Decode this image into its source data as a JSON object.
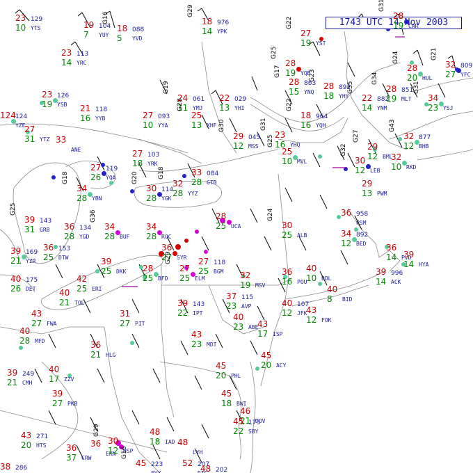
{
  "title": "1743 UTC 14 Nov 2003",
  "colors": {
    "background": "#ffffff",
    "boundary": "#7a7a7a",
    "temperature": "#cc0000",
    "dewpoint": "#008800",
    "station_id": "#1a1aa0",
    "wind_barb": "#000000",
    "gust": "#000000",
    "weather": "#a000a0",
    "cloud_clear": "#55cc99",
    "cloud_broken": "#2222cc",
    "cloud_overcast": "#d400d4",
    "cloud_obscured": "#dd0000"
  },
  "legend_note": "Temperature (red) upper-left, dewpoint (green) lower-left, pressure/station right",
  "stations": [
    {
      "id": "YTS",
      "t": "23",
      "td": "10",
      "p": "129",
      "c": "",
      "g": ""
    },
    {
      "id": "YUY",
      "t": "19",
      "td": "7",
      "p": "104",
      "c": "",
      "g": ""
    },
    {
      "id": "YVD",
      "t": "18",
      "td": "5",
      "p": "088",
      "c": "",
      "g": "G16"
    },
    {
      "id": "YPK",
      "t": "18",
      "td": "14",
      "p": "976",
      "c": "",
      "g": "G29"
    },
    {
      "id": "YST",
      "t": "27",
      "td": "19",
      "p": "",
      "c": "",
      "g": "G22"
    },
    {
      "id": "CAR",
      "t": "28",
      "td": "19",
      "p": "",
      "c": "broken",
      "g": "G31"
    },
    {
      "id": "YRC",
      "t": "23",
      "td": "14",
      "p": "113",
      "c": "",
      "g": ""
    },
    {
      "id": "YQB",
      "t": "28",
      "td": "19",
      "p": "",
      "c": "obscured",
      "g": "G25"
    },
    {
      "id": "HUL",
      "t": "28",
      "td": "20",
      "p": "",
      "c": "clear",
      "g": "G24"
    },
    {
      "id": "YFC",
      "t": "32",
      "td": "27",
      "p": "809",
      "c": "broken",
      "g": "G21"
    },
    {
      "id": "YSB",
      "t": "23",
      "td": "19",
      "p": "126",
      "c": "clear",
      "g": ""
    },
    {
      "id": "YYB",
      "t": "21",
      "td": "16",
      "p": "118",
      "c": "",
      "g": ""
    },
    {
      "id": "YYA",
      "t": "27",
      "td": "10",
      "p": "093",
      "c": "",
      "g": ""
    },
    {
      "id": "YMJ",
      "t": "24",
      "td": "11",
      "p": "061",
      "c": "",
      "g": "G19"
    },
    {
      "id": "YHI",
      "t": "22",
      "td": "13",
      "p": "029",
      "c": "",
      "g": ""
    },
    {
      "id": "YHY",
      "t": "28",
      "td": "18",
      "p": "892",
      "c": "",
      "g": "G23"
    },
    {
      "id": "YNM",
      "t": "22",
      "td": "14",
      "p": "882",
      "c": "",
      "g": "G35"
    },
    {
      "id": "MLT",
      "t": "28",
      "td": "19",
      "p": "851",
      "c": "",
      "g": "G34"
    },
    {
      "id": "YSJ",
      "t": "34",
      "td": "23",
      "p": "",
      "c": "clear",
      "g": "G31"
    },
    {
      "id": "XHF",
      "t": "25",
      "td": "13",
      "p": "",
      "c": "",
      "g": "G28"
    },
    {
      "id": "YNQ",
      "t": "28",
      "td": "15",
      "p": "863",
      "c": "",
      "g": "G17"
    },
    {
      "id": "YTZ",
      "t": "27",
      "td": "31",
      "p": "",
      "c": "",
      "g": ""
    },
    {
      "id": "YZE",
      "t": "124",
      "td": "",
      "p": "124",
      "c": "clear",
      "g": ""
    },
    {
      "id": "ANE",
      "t": "33",
      "td": "",
      "p": "",
      "c": "",
      "g": ""
    },
    {
      "id": "MSS",
      "t": "29",
      "td": "12",
      "p": "045",
      "c": "",
      "g": "G30"
    },
    {
      "id": "YHQ",
      "t": "23",
      "td": "16",
      "p": "",
      "c": "",
      "g": "G31"
    },
    {
      "id": "YQH",
      "t": "18",
      "td": "16",
      "p": "964",
      "c": "",
      "g": "G22"
    },
    {
      "id": "BHB",
      "t": "32",
      "td": "12",
      "p": "877",
      "c": "clear",
      "g": "G43"
    },
    {
      "id": "YRK",
      "t": "27",
      "td": "18",
      "p": "103",
      "c": "",
      "g": ""
    },
    {
      "id": "YQA",
      "t": "27",
      "td": "26",
      "p": "119",
      "c": "broken",
      "g": ""
    },
    {
      "id": "YGK",
      "t": "30",
      "td": "28",
      "p": "114",
      "c": "broken",
      "g": "G20"
    },
    {
      "id": "YYZ",
      "t": "32",
      "td": "28",
      "p": "",
      "c": "",
      "g": "G18"
    },
    {
      "id": "GTB",
      "t": "33",
      "td": "28",
      "p": "084",
      "c": "",
      "g": ""
    },
    {
      "id": "MVL",
      "t": "25",
      "td": "10",
      "p": "",
      "c": "clear",
      "g": "G25"
    },
    {
      "id": "LEB",
      "t": "30",
      "td": "12",
      "p": "",
      "c": "broken",
      "g": "G32"
    },
    {
      "id": "RKD",
      "t": "32",
      "td": "10",
      "p": "",
      "c": "clear",
      "g": ""
    },
    {
      "id": "BML",
      "t": "29",
      "td": "12",
      "p": "",
      "c": "",
      "g": "G27"
    },
    {
      "id": "PWM",
      "t": "29",
      "td": "13",
      "p": "",
      "c": "",
      "g": ""
    },
    {
      "id": "YBN",
      "t": "34",
      "td": "28",
      "p": "",
      "c": "clear",
      "g": "G18"
    },
    {
      "id": "GRB",
      "t": "39",
      "td": "31",
      "p": "143",
      "c": "",
      "g": "G25"
    },
    {
      "id": "YGD",
      "t": "36",
      "td": "28",
      "p": "134",
      "c": "",
      "g": ""
    },
    {
      "id": "BUF",
      "t": "34",
      "td": "28",
      "p": "",
      "c": "overcast",
      "g": "G36"
    },
    {
      "id": "UCA",
      "t": "28",
      "td": "25",
      "p": "",
      "c": "overcast",
      "g": ""
    },
    {
      "id": "ALB",
      "t": "30",
      "td": "25",
      "p": "",
      "c": "",
      "g": "G24"
    },
    {
      "id": "PSM",
      "t": "36",
      "td": "",
      "p": "958",
      "c": "",
      "g": ""
    },
    {
      "id": "BED",
      "t": "34",
      "td": "12",
      "p": "892",
      "c": "clear",
      "g": ""
    },
    {
      "id": "ROC",
      "t": "34",
      "td": "28",
      "p": "",
      "c": "overcast",
      "g": ""
    },
    {
      "id": "YZR",
      "t": "39",
      "td": "21",
      "p": "169",
      "c": "clear",
      "g": ""
    },
    {
      "id": "DTW",
      "t": "36",
      "td": "25",
      "p": "153",
      "c": "",
      "g": ""
    },
    {
      "id": "SYR",
      "t": "36",
      "td": "27",
      "p": "",
      "c": "obscured",
      "g": ""
    },
    {
      "id": "ELM",
      "t": "27",
      "td": "25",
      "p": "",
      "c": "overcast",
      "g": "G29"
    },
    {
      "id": "BGM",
      "t": "27",
      "td": "25",
      "p": "118",
      "c": "",
      "g": ""
    },
    {
      "id": "ACK",
      "t": "39",
      "td": "14",
      "p": "996",
      "c": "",
      "g": ""
    },
    {
      "id": "PVD",
      "t": "36",
      "td": "14",
      "p": "",
      "c": "",
      "g": ""
    },
    {
      "id": "HYA",
      "t": "39",
      "td": "14",
      "p": "",
      "c": "",
      "g": ""
    },
    {
      "id": "DKK",
      "t": "39",
      "td": "25",
      "p": "",
      "c": "",
      "g": ""
    },
    {
      "id": "ERI",
      "t": "42",
      "td": "25",
      "p": "",
      "c": "",
      "g": ""
    },
    {
      "id": "BFD",
      "t": "28",
      "td": "25",
      "p": "",
      "c": "clear",
      "g": ""
    },
    {
      "id": "MSV",
      "t": "32",
      "td": "19",
      "p": "",
      "c": "",
      "g": ""
    },
    {
      "id": "POU",
      "t": "36",
      "td": "16",
      "p": "",
      "c": "",
      "g": ""
    },
    {
      "id": "BDL",
      "t": "40",
      "td": "10",
      "p": "",
      "c": "",
      "g": ""
    },
    {
      "id": "BID",
      "t": "40",
      "td": "8",
      "p": "",
      "c": "",
      "g": ""
    },
    {
      "id": "DET",
      "t": "40",
      "td": "26",
      "p": "175",
      "c": "",
      "g": ""
    },
    {
      "id": "TOL",
      "t": "40",
      "td": "21",
      "p": "",
      "c": "",
      "g": ""
    },
    {
      "id": "AVP",
      "t": "37",
      "td": "23",
      "p": "115",
      "c": "",
      "g": ""
    },
    {
      "id": "FOK",
      "t": "43",
      "td": "12",
      "p": "",
      "c": "",
      "g": ""
    },
    {
      "id": "JFK",
      "t": "40",
      "td": "12",
      "p": "107",
      "c": "",
      "g": ""
    },
    {
      "id": "FWA",
      "t": "43",
      "td": "27",
      "p": "",
      "c": "",
      "g": ""
    },
    {
      "id": "MFD",
      "t": "40",
      "td": "28",
      "p": "",
      "c": "",
      "g": ""
    },
    {
      "id": "PIT",
      "t": "31",
      "td": "27",
      "p": "",
      "c": "",
      "g": ""
    },
    {
      "id": "IPT",
      "t": "39",
      "td": "22",
      "p": "143",
      "c": "",
      "g": ""
    },
    {
      "id": "ABE",
      "t": "40",
      "td": "23",
      "p": "",
      "c": "",
      "g": ""
    },
    {
      "id": "ISP",
      "t": "43",
      "td": "17",
      "p": "",
      "c": "",
      "g": ""
    },
    {
      "id": "CMH",
      "t": "39",
      "td": "21",
      "p": "249",
      "c": "",
      "g": ""
    },
    {
      "id": "ZZV",
      "t": "40",
      "td": "17",
      "p": "",
      "c": "",
      "g": ""
    },
    {
      "id": "MDT",
      "t": "43",
      "td": "23",
      "p": "",
      "c": "",
      "g": ""
    },
    {
      "id": "PHL",
      "t": "45",
      "td": "20",
      "p": "",
      "c": "",
      "g": ""
    },
    {
      "id": "ACY",
      "t": "45",
      "td": "20",
      "p": "",
      "c": "",
      "g": ""
    },
    {
      "id": "PKB",
      "t": "39",
      "td": "27",
      "p": "",
      "c": "",
      "g": ""
    },
    {
      "id": "HLG",
      "t": "36",
      "td": "21",
      "p": "",
      "c": "",
      "g": ""
    },
    {
      "id": "BWI",
      "t": "45",
      "td": "18",
      "p": "",
      "c": "",
      "g": ""
    },
    {
      "id": "DOV",
      "t": "46",
      "td": "21",
      "p": "",
      "c": "",
      "g": ""
    },
    {
      "id": "HTS",
      "t": "43",
      "td": "20",
      "p": "271",
      "c": "",
      "g": ""
    },
    {
      "id": "CRW",
      "t": "36",
      "td": "37",
      "p": "",
      "c": "",
      "g": ""
    },
    {
      "id": "EKN",
      "t": "36",
      "td": "",
      "p": "",
      "c": "",
      "g": ""
    },
    {
      "id": "IAD",
      "t": "48",
      "td": "18",
      "p": "",
      "c": "",
      "g": ""
    },
    {
      "id": "SBY",
      "t": "45",
      "td": "22",
      "p": "173",
      "c": "",
      "g": ""
    },
    {
      "id": "HSP",
      "t": "30",
      "td": "12",
      "p": "",
      "c": "overcast",
      "g": "G29"
    },
    {
      "id": "LYH",
      "t": "48",
      "td": "",
      "p": "",
      "c": "",
      "g": ""
    },
    {
      "id": "RIC",
      "t": "52",
      "td": "",
      "p": "207",
      "c": "",
      "g": ""
    },
    {
      "id": "ORF",
      "t": "48",
      "td": "",
      "p": "202",
      "c": "",
      "g": ""
    },
    {
      "id": "LUK",
      "t": "38",
      "td": "",
      "p": "286",
      "c": "",
      "g": ""
    },
    {
      "id": "FVX",
      "t": "45",
      "td": "",
      "p": "223",
      "c": "",
      "g": "G16"
    }
  ]
}
